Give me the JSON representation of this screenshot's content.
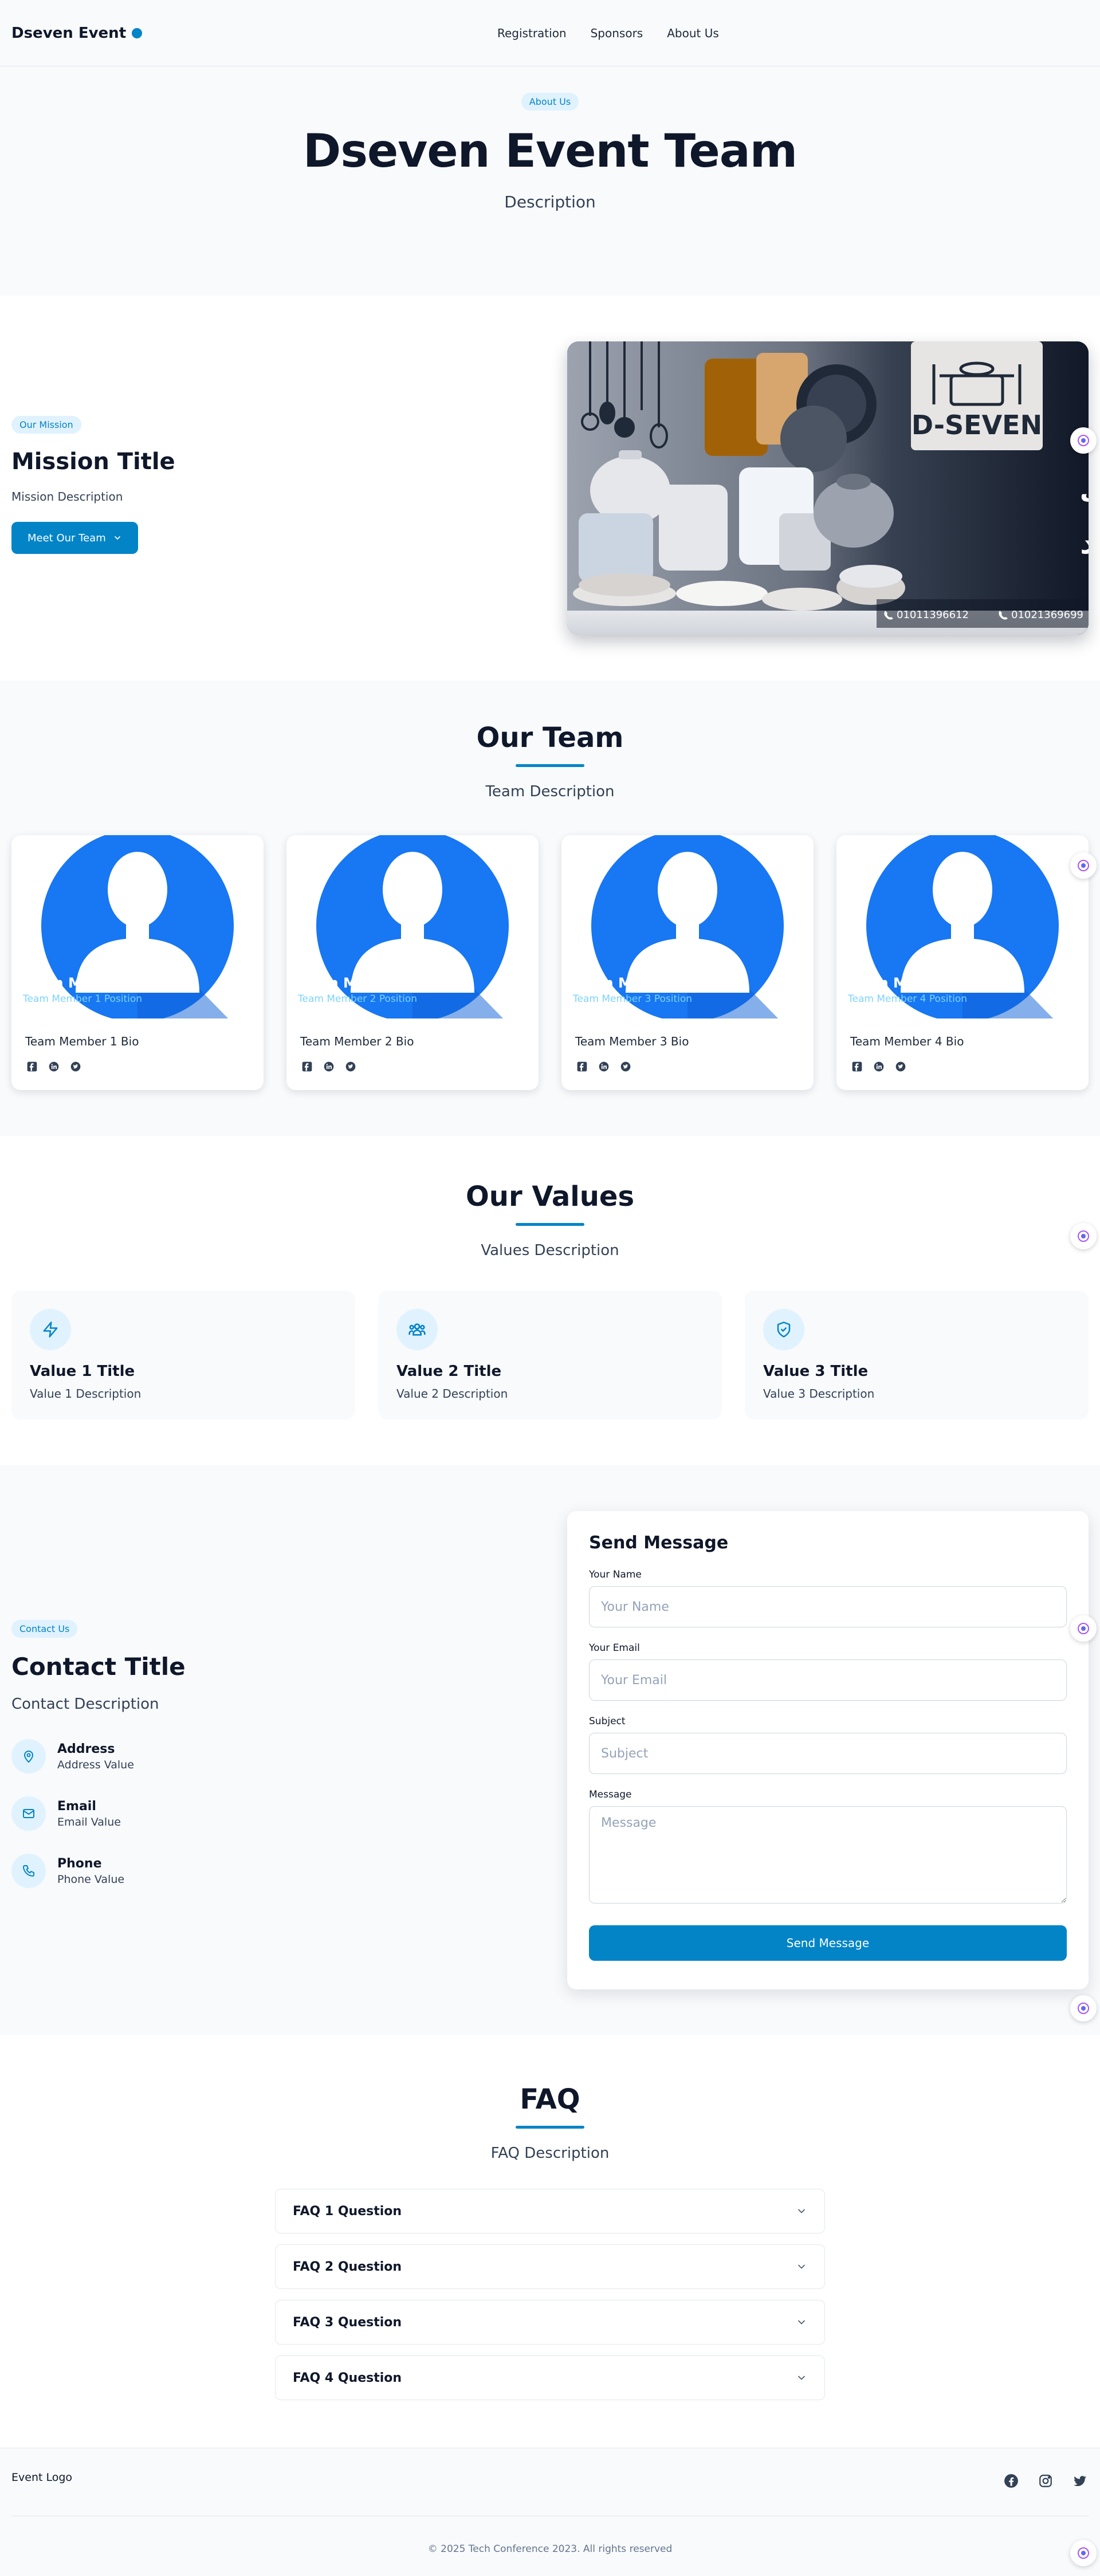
{
  "header": {
    "logo_text": "Dseven Event",
    "nav": [
      "Registration",
      "Sponsors",
      "About Us"
    ]
  },
  "hero": {
    "badge": "About Us",
    "title": "Dseven Event Team",
    "description": "Description"
  },
  "mission": {
    "badge": "Our Mission",
    "title": "Mission Title",
    "description": "Mission Description",
    "button_label": "Meet Our Team",
    "image": {
      "brand": "D-SEVEN",
      "arabic_line1": "كل أدوات ست البيت",
      "arabic_line2": "في مكان واحد",
      "phone1": "01011396612",
      "phone2": "01021369699"
    }
  },
  "team": {
    "title": "Our Team",
    "description": "Team Description",
    "members": [
      {
        "name": "Team Member 1",
        "position": "Team Member 1 Position",
        "bio": "Team Member 1 Bio"
      },
      {
        "name": "Team Member 2",
        "position": "Team Member 2 Position",
        "bio": "Team Member 2 Bio"
      },
      {
        "name": "Team Member 3",
        "position": "Team Member 3 Position",
        "bio": "Team Member 3 Bio"
      },
      {
        "name": "Team Member 4",
        "position": "Team Member 4 Position",
        "bio": "Team Member 4 Bio"
      }
    ]
  },
  "values": {
    "title": "Our Values",
    "description": "Values Description",
    "items": [
      {
        "icon": "lightning-icon",
        "title": "Value 1 Title",
        "description": "Value 1 Description"
      },
      {
        "icon": "users-icon",
        "title": "Value 2 Title",
        "description": "Value 2 Description"
      },
      {
        "icon": "shield-check-icon",
        "title": "Value 3 Title",
        "description": "Value 3 Description"
      }
    ]
  },
  "contact": {
    "badge": "Contact Us",
    "title": "Contact Title",
    "description": "Contact Description",
    "items": [
      {
        "icon": "location-pin-icon",
        "label": "Address",
        "value": "Address Value"
      },
      {
        "icon": "mail-icon",
        "label": "Email",
        "value": "Email Value"
      },
      {
        "icon": "phone-icon",
        "label": "Phone",
        "value": "Phone Value"
      }
    ],
    "form": {
      "title": "Send Message",
      "name_label": "Your Name",
      "name_placeholder": "Your Name",
      "email_label": "Your Email",
      "email_placeholder": "Your Email",
      "subject_label": "Subject",
      "subject_placeholder": "Subject",
      "message_label": "Message",
      "message_placeholder": "Message",
      "submit_label": "Send Message"
    }
  },
  "faq": {
    "title": "FAQ",
    "description": "FAQ Description",
    "items": [
      "FAQ 1 Question",
      "FAQ 2 Question",
      "FAQ 3 Question",
      "FAQ 4 Question"
    ]
  },
  "footer": {
    "logo_alt": "Event Logo",
    "social": [
      "facebook-icon",
      "instagram-icon",
      "twitter-icon"
    ],
    "copyright": "© 2025 Tech Conference 2023. All rights reserved"
  },
  "colors": {
    "primary": "#0284c7",
    "dark": "#0f172a",
    "light_bg": "#f8fafc",
    "avatar_blue": "#1877f2"
  }
}
